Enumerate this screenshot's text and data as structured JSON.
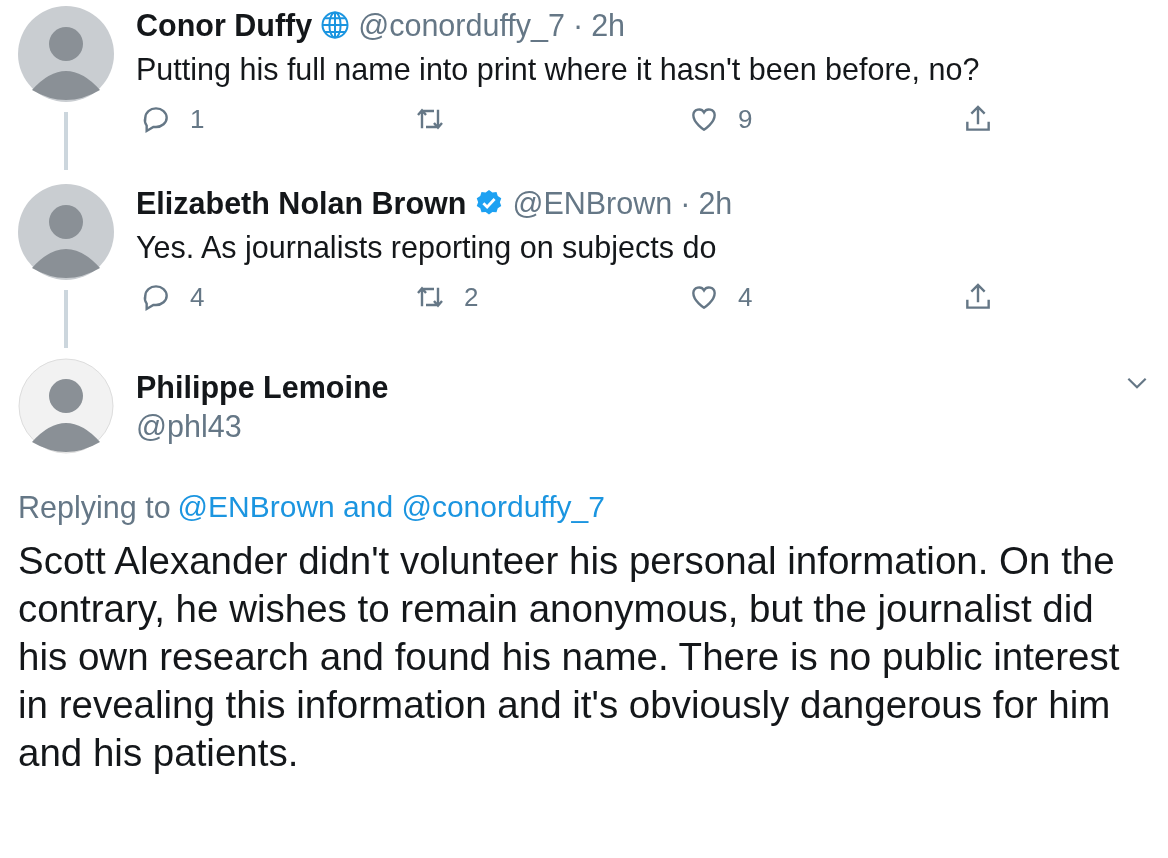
{
  "replies": [
    {
      "name": "Conor Duffy",
      "badge": {
        "kind": "globe"
      },
      "handle": "@conorduffy_7",
      "separator": "·",
      "time": "2h",
      "text": "Putting his full name into print where it hasn't been before, no?",
      "actions": [
        {
          "kind": "reply",
          "count": "1"
        },
        {
          "kind": "retweet"
        },
        {
          "kind": "like",
          "count": "9"
        },
        {
          "kind": "share"
        }
      ]
    },
    {
      "name": "Elizabeth Nolan Brown",
      "badge": {
        "kind": "verified"
      },
      "handle": "@ENBrown",
      "separator": "·",
      "time": "2h",
      "text": "Yes. As journalists reporting on subjects do",
      "actions": [
        {
          "kind": "reply",
          "count": "4"
        },
        {
          "kind": "retweet",
          "count": "2"
        },
        {
          "kind": "like",
          "count": "4"
        },
        {
          "kind": "share"
        }
      ]
    }
  ],
  "main_tweet": {
    "name": "Philippe Lemoine",
    "handle": "@phl43",
    "replying_prefix": "Replying to",
    "replying_targets": "@ENBrown and @conorduffy_7",
    "text": "Scott Alexander didn't volunteer his personal information. On the contrary, he wishes to remain anonymous, but the journalist did his own research and found his name. There is no public interest in revealing this information and it's obviously dangerous for him and his patients."
  }
}
